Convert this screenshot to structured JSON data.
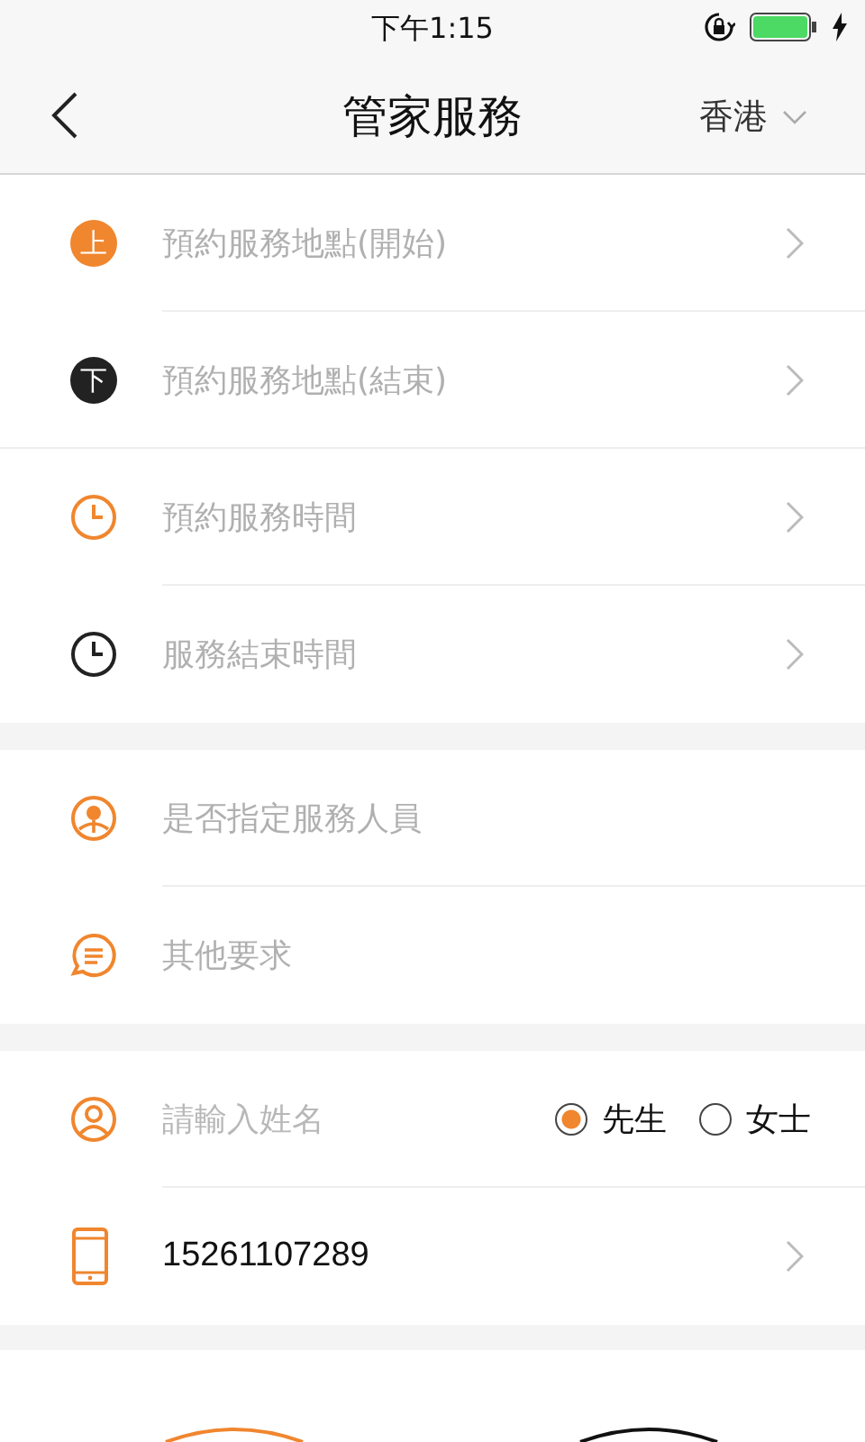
{
  "status_bar": {
    "time": "下午1:15"
  },
  "nav": {
    "title": "管家服務",
    "region": "香港"
  },
  "sections": [
    {
      "rows": [
        {
          "kind": "badge",
          "badge": "上",
          "color": "#f0862e",
          "label": "預約服務地點(開始)",
          "chevron": true
        },
        {
          "kind": "badge",
          "badge": "下",
          "color": "#222222",
          "label": "預約服務地點(結束)",
          "chevron": true
        },
        {
          "kind": "clock",
          "color": "#f0862e",
          "label": "預約服務時間",
          "chevron": true
        },
        {
          "kind": "clock",
          "color": "#222222",
          "label": "服務結束時間",
          "chevron": true
        }
      ]
    },
    {
      "rows": [
        {
          "kind": "staff",
          "color": "#f0862e",
          "label": "是否指定服務人員",
          "chevron": false
        },
        {
          "kind": "chat",
          "color": "#f0862e",
          "label": "其他要求",
          "chevron": false
        }
      ]
    },
    {
      "rows": [
        {
          "kind": "name",
          "color": "#f0862e",
          "placeholder": "請輸入姓名",
          "options": [
            {
              "label": "先生",
              "selected": true
            },
            {
              "label": "女士",
              "selected": false
            }
          ]
        },
        {
          "kind": "phone",
          "color": "#f0862e",
          "value": "15261107289",
          "chevron": true
        }
      ]
    }
  ]
}
